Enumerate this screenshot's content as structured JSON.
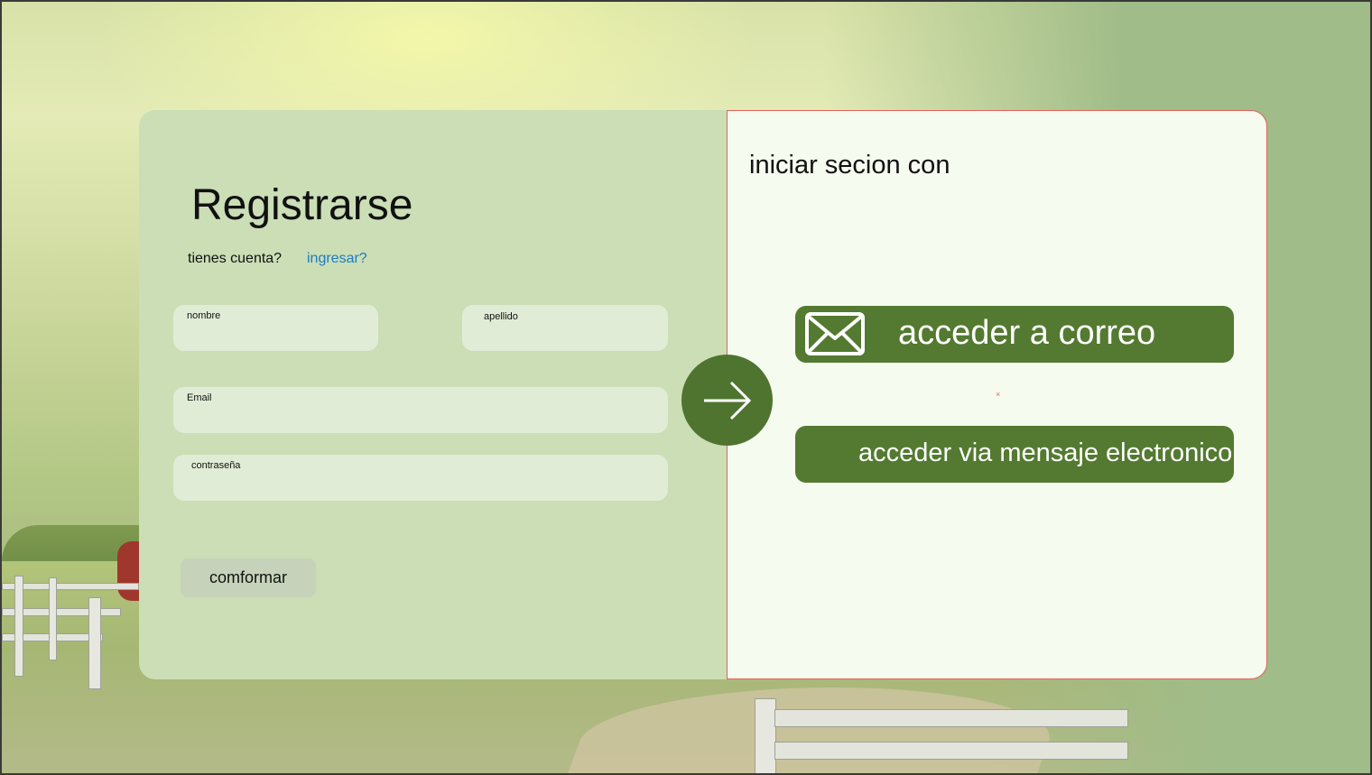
{
  "register": {
    "title": "Registrarse",
    "have_account": "tienes cuenta?",
    "login_link": "ingresar?",
    "fields": {
      "first_name": {
        "label": "nombre",
        "value": ""
      },
      "last_name": {
        "label": "apellido",
        "value": ""
      },
      "email": {
        "label": "Email",
        "value": ""
      },
      "password": {
        "label": "contraseña",
        "value": ""
      }
    },
    "confirm_label": "comformar"
  },
  "login": {
    "title": "iniciar secion con",
    "email_button": "acceder a correo",
    "sms_button": "acceder via mensaje electronico",
    "mark": "×"
  },
  "colors": {
    "primary_green": "#537a30",
    "panel_left": "#cbdeb6",
    "panel_right": "#f6fbef",
    "link_blue": "#1f7bbf",
    "panel_border": "#e0645a"
  },
  "icons": {
    "arrow_button": "arrow-right-icon",
    "email_button": "envelope-icon"
  }
}
